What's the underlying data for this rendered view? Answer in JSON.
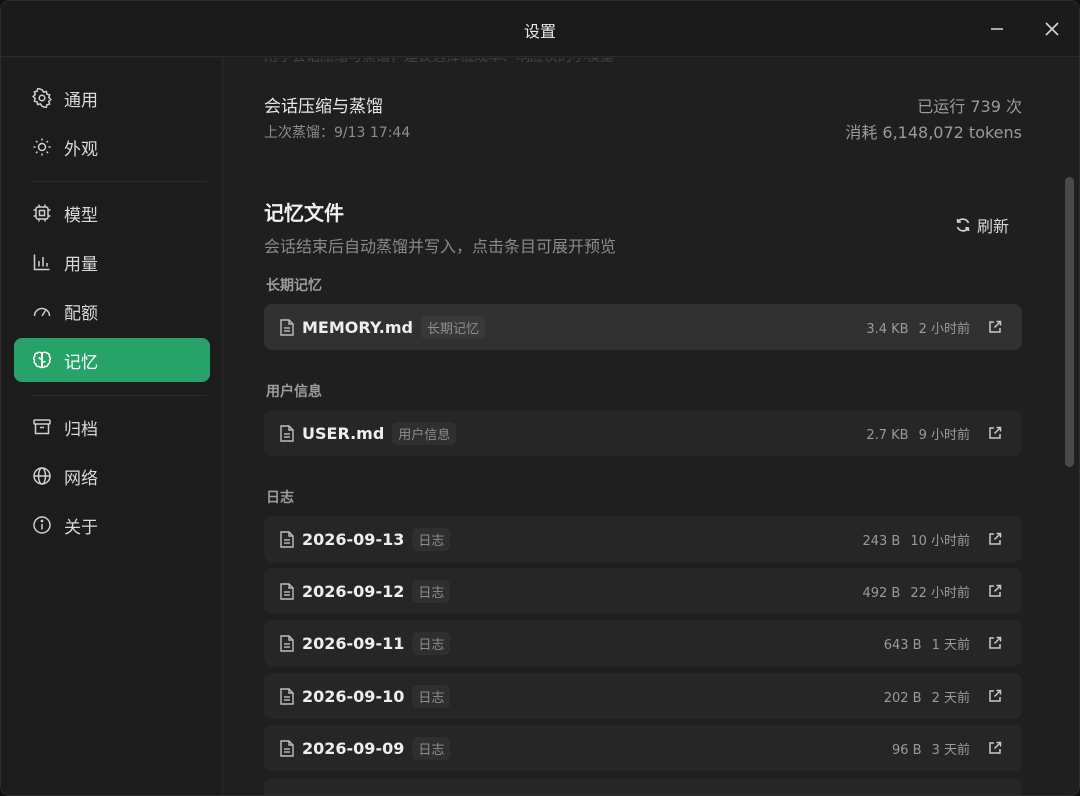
{
  "window": {
    "title": "设置"
  },
  "sidebar": {
    "items": [
      {
        "label": "通用",
        "icon": "gear-icon"
      },
      {
        "label": "外观",
        "icon": "sun-icon"
      },
      {
        "label": "模型",
        "icon": "chip-icon"
      },
      {
        "label": "用量",
        "icon": "bar-chart-icon"
      },
      {
        "label": "配额",
        "icon": "gauge-icon"
      },
      {
        "label": "记忆",
        "icon": "brain-icon",
        "active": true
      },
      {
        "label": "归档",
        "icon": "archive-icon"
      },
      {
        "label": "网络",
        "icon": "globe-icon"
      },
      {
        "label": "关于",
        "icon": "info-icon"
      }
    ],
    "active_color": "#27a36a"
  },
  "main": {
    "faded_text": "用于会话压缩与蒸馏，建议选择低成本、响应快的小模型",
    "compression": {
      "title": "会话压缩与蒸馏",
      "last_distill": "上次蒸馏：9/13 17:44",
      "runs": "已运行 739 次",
      "tokens": "消耗 6,148,072 tokens"
    },
    "memory_files": {
      "title": "记忆文件",
      "description": "会话结束后自动蒸馏并写入，点击条目可展开预览",
      "refresh_label": "刷新"
    },
    "groups": [
      {
        "label": "长期记忆",
        "files": [
          {
            "name": "MEMORY.md",
            "tag": "长期记忆",
            "size": "3.4 KB",
            "time": "2 小时前"
          }
        ]
      },
      {
        "label": "用户信息",
        "files": [
          {
            "name": "USER.md",
            "tag": "用户信息",
            "size": "2.7 KB",
            "time": "9 小时前"
          }
        ]
      },
      {
        "label": "日志",
        "files": [
          {
            "name": "2026-09-13",
            "tag": "日志",
            "size": "243 B",
            "time": "10 小时前"
          },
          {
            "name": "2026-09-12",
            "tag": "日志",
            "size": "492 B",
            "time": "22 小时前"
          },
          {
            "name": "2026-09-11",
            "tag": "日志",
            "size": "643 B",
            "time": "1 天前"
          },
          {
            "name": "2026-09-10",
            "tag": "日志",
            "size": "202 B",
            "time": "2 天前"
          },
          {
            "name": "2026-09-09",
            "tag": "日志",
            "size": "96 B",
            "time": "3 天前"
          }
        ]
      }
    ]
  }
}
